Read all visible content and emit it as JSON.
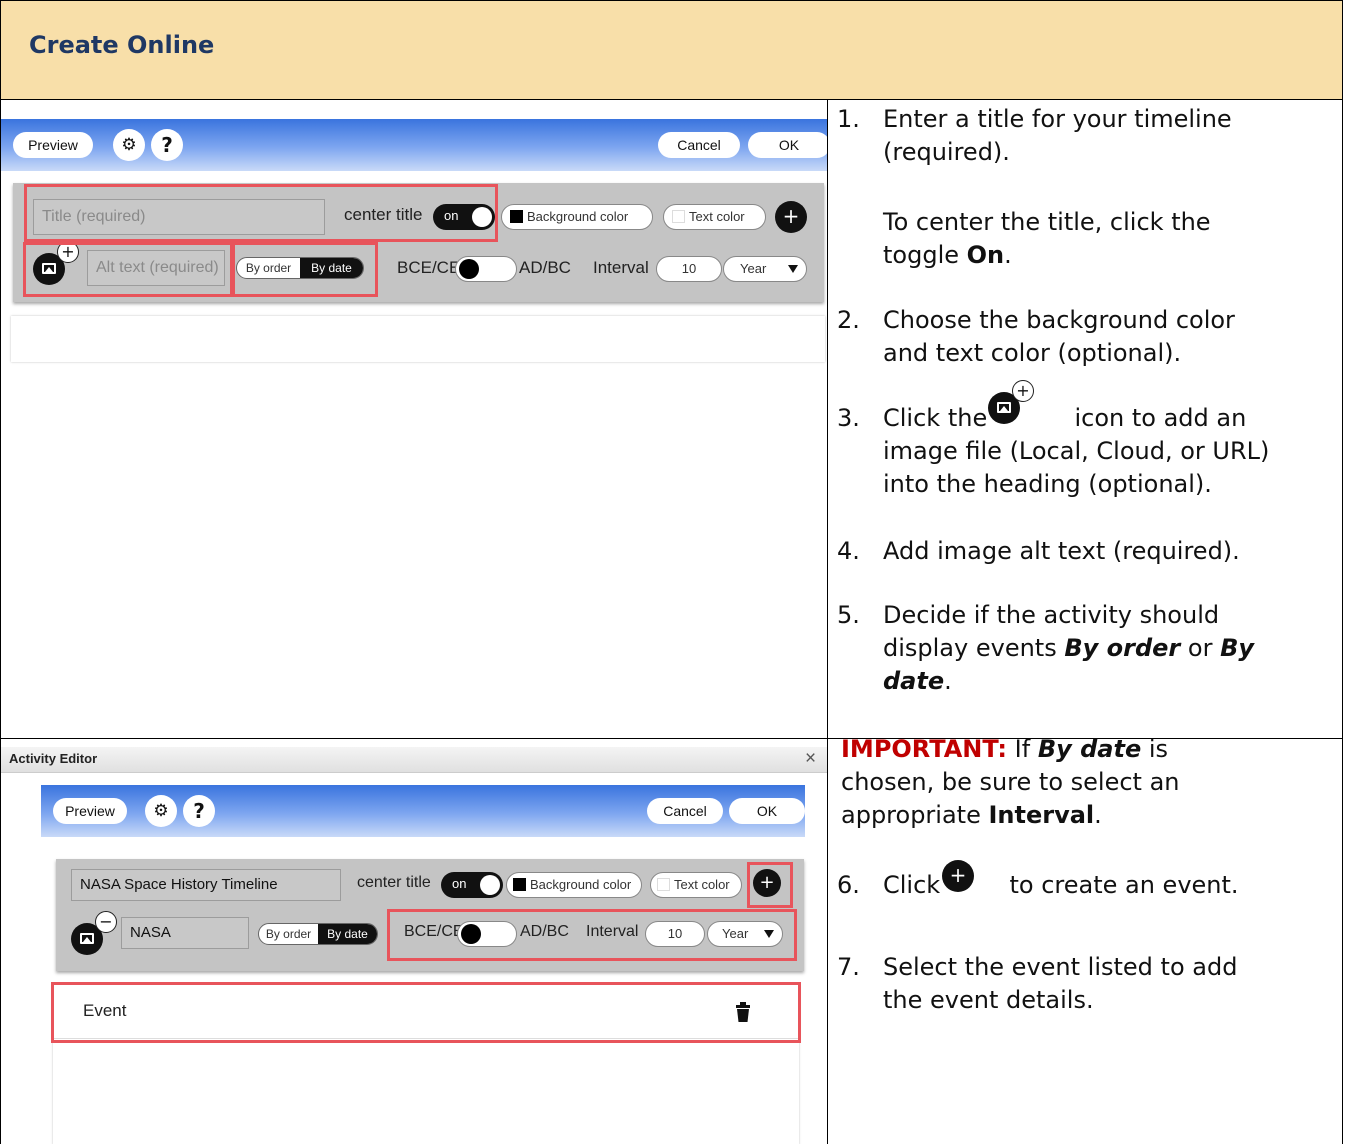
{
  "header": {
    "title": "Create Online"
  },
  "editor1": {
    "preview_label": "Preview",
    "settings_icon": "gear-icon",
    "help_label": "?",
    "cancel_label": "Cancel",
    "ok_label": "OK",
    "title_placeholder": "Title (required)",
    "center_title_label": "center title",
    "toggle_on_label": "on",
    "background_color_label": "Background color",
    "text_color_label": "Text color",
    "add_label": "+",
    "alt_placeholder": "Alt text (required)",
    "by_order_label": "By order",
    "by_date_label": "By date",
    "bce_label": "BCE/CE",
    "adbc_label": "AD/BC",
    "interval_label": "Interval",
    "interval_value": "10",
    "unit_value": "Year",
    "image_badge": "+"
  },
  "editor2": {
    "window_title": "Activity Editor",
    "close_label": "×",
    "preview_label": "Preview",
    "help_label": "?",
    "cancel_label": "Cancel",
    "ok_label": "OK",
    "title_value": "NASA Space History Timeline",
    "center_title_label": "center title",
    "toggle_on_label": "on",
    "background_color_label": "Background color",
    "text_color_label": "Text color",
    "add_label": "+",
    "alt_value": "NASA",
    "by_order_label": "By order",
    "by_date_label": "By date",
    "bce_label": "BCE/CE",
    "adbc_label": "AD/BC",
    "interval_label": "Interval",
    "interval_value": "10",
    "unit_value": "Year",
    "image_badge": "−",
    "event_label": "Event",
    "trash_icon": "trash-icon"
  },
  "steps": {
    "s1": {
      "num": "1.",
      "line1": "Enter a title for your timeline",
      "line2": "(required)."
    },
    "s1b": {
      "line1": "To center the title, click the",
      "line2a": "toggle ",
      "line2b": "On",
      "line2c": "."
    },
    "s2": {
      "num": "2.",
      "line1": "Choose the background color",
      "line2": "and text color (optional)."
    },
    "s3": {
      "num": "3.",
      "line1a": "Click the",
      "line1b": "icon to add an",
      "line2": "image file (Local, Cloud, or URL)",
      "line3": "into the heading (optional)."
    },
    "s4": {
      "num": "4.",
      "line1": "Add image alt text (required)."
    },
    "s5": {
      "num": "5.",
      "line1": "Decide if the activity should",
      "line2a": "display events ",
      "line2b": "By order",
      "line2c": " or ",
      "line2d": "By",
      "line3a": "date",
      "line3b": "."
    },
    "important": {
      "label": "IMPORTANT:",
      "t1": " If ",
      "t2": "By date",
      "t3": " is",
      "line2": "chosen, be sure to select an",
      "line3a": "appropriate ",
      "line3b": "Interval",
      "line3c": "."
    },
    "s6": {
      "num": "6.",
      "line1a": "Click",
      "line1b": "to create an event."
    },
    "s7": {
      "num": "7.",
      "line1": "Select the event listed to add",
      "line2": "the event details."
    }
  }
}
